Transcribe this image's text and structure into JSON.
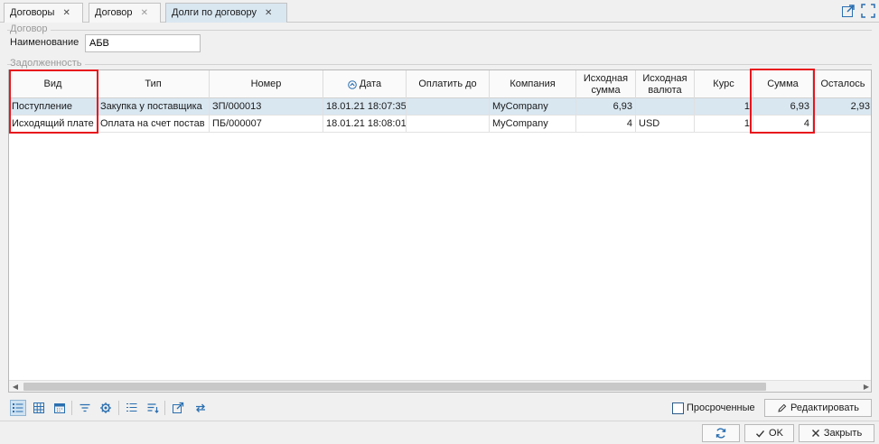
{
  "tabs": [
    {
      "label": "Договоры",
      "close": "✕"
    },
    {
      "label": "Договор",
      "close": "✕"
    },
    {
      "label": "Долги по договору",
      "close": "✕"
    }
  ],
  "contract_group": {
    "legend": "Договор",
    "name_label": "Наименование",
    "name_value": "АБВ"
  },
  "debt_group": {
    "legend": "Задолженность"
  },
  "grid": {
    "columns": [
      "Вид",
      "Тип",
      "Номер",
      "Дата",
      "Оплатить до",
      "Компания",
      "Исходная сумма",
      "Исходная валюта",
      "Курс",
      "Сумма",
      "Осталось"
    ],
    "rows": [
      [
        "Поступление",
        "Закупка у поставщика",
        "ЗП/000013",
        "18.01.21 18:07:35",
        "",
        "MyCompany",
        "6,93",
        "",
        "1",
        "6,93",
        "2,93"
      ],
      [
        "Исходящий плате",
        "Оплата на счет постав",
        "ПБ/000007",
        "18.01.21 18:08:01",
        "",
        "MyCompany",
        "4",
        "USD",
        "1",
        "4",
        ""
      ]
    ]
  },
  "toolbar": {
    "icons": [
      "list-view-icon",
      "grid-view-icon",
      "calendar-view-icon",
      "filter-icon",
      "settings-icon",
      "numbered-list-icon",
      "sort-icon",
      "export-icon",
      "sync-icon"
    ],
    "overdue_label": "Просроченные",
    "edit_label": "Редактировать"
  },
  "footer": {
    "ok_label": "OK",
    "close_label": "Закрыть"
  },
  "colors": {
    "selection": "#d9e7f1",
    "highlight": "#e8141c",
    "accent": "#2a6fb0"
  }
}
